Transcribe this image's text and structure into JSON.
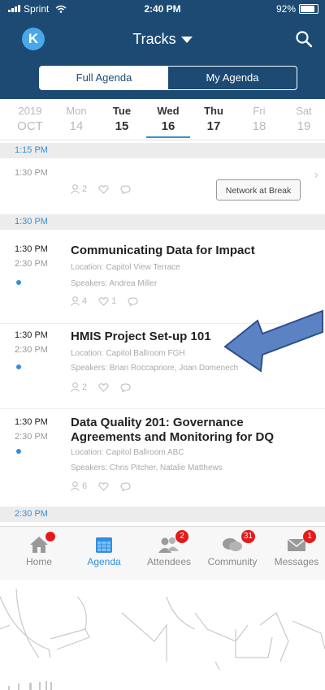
{
  "status_bar": {
    "carrier": "Sprint",
    "time": "2:40 PM",
    "battery": "92%",
    "battery_level": 0.92
  },
  "nav": {
    "avatar_letter": "K",
    "title": "Tracks"
  },
  "segments": {
    "full": "Full Agenda",
    "mine": "My Agenda"
  },
  "dates": [
    {
      "top": "2019",
      "bottom": "OCT"
    },
    {
      "top": "Mon",
      "bottom": "14"
    },
    {
      "top": "Tue",
      "bottom": "15"
    },
    {
      "top": "Wed",
      "bottom": "16"
    },
    {
      "top": "Thu",
      "bottom": "17"
    },
    {
      "top": "Fri",
      "bottom": "18"
    },
    {
      "top": "Sat",
      "bottom": "19"
    }
  ],
  "section_1": "1:15 PM",
  "break_item": {
    "start": "1:30 PM",
    "users": "2",
    "action": "Network at Break"
  },
  "section_2": "1:30 PM",
  "sessions": [
    {
      "start": "1:30 PM",
      "end": "2:30 PM",
      "title": "Communicating Data for Impact",
      "location": "Location: Capitol View Terrace",
      "speakers": "Speakers: Andrea Miller",
      "users": "4",
      "likes": "1"
    },
    {
      "start": "1:30 PM",
      "end": "2:30 PM",
      "title": "HMIS Project Set-up 101",
      "location": "Location: Capitol Ballroom FGH",
      "speakers": "Speakers: Brian Roccapriore, Joan Domenech",
      "users": "2",
      "likes": ""
    },
    {
      "start": "1:30 PM",
      "end": "2:30 PM",
      "title": "Data Quality 201: Governance Agreements and Monitoring for DQ",
      "location": "Location: Capitol Ballroom ABC",
      "speakers": "Speakers: Chris Pitcher, Natalie Matthews",
      "users": "6",
      "likes": ""
    }
  ],
  "section_3": "2:30 PM",
  "tabs": [
    {
      "label": "Home",
      "badge": ""
    },
    {
      "label": "Agenda",
      "badge": ""
    },
    {
      "label": "Attendees",
      "badge": "2"
    },
    {
      "label": "Community",
      "badge": "31"
    },
    {
      "label": "Messages",
      "badge": "1"
    }
  ],
  "colors": {
    "header": "#1c4a73",
    "accent": "#3b8fd0",
    "badge": "#e31b1b",
    "arrow": "#5b83c4"
  }
}
